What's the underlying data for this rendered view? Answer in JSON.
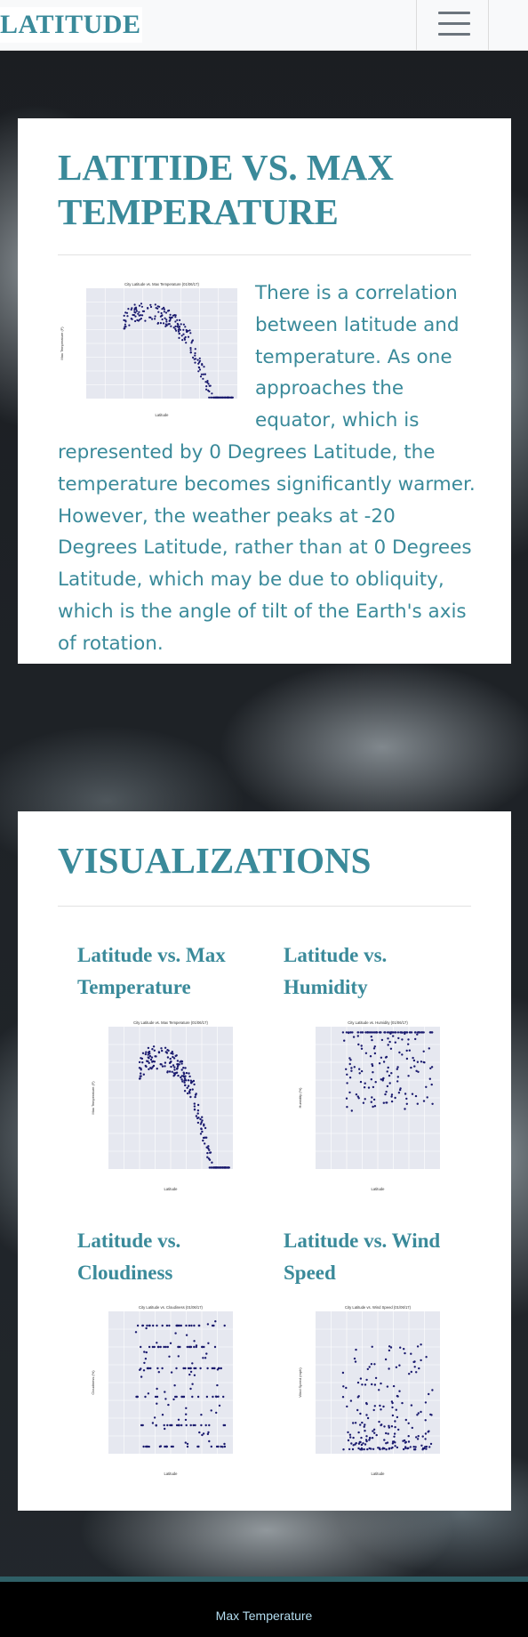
{
  "navbar": {
    "brand": "LATITUDE",
    "toggle_icon": "hamburger-menu-icon"
  },
  "summary": {
    "title": "LATITIDE VS. MAX TEMPERATURE",
    "description": "There is a correlation between latitude and temperature. As one approaches the equator, which is represented by 0 Degrees Latitude, the temperature becomes significantly warmer. However, the weather peaks at -20 Degrees Latitude, rather than at 0 Degrees Latitude, which may be due to obliquity, which is the angle of tilt of the Earth's axis of rotation."
  },
  "visualizations": {
    "title": "VISUALIZATIONS",
    "items": [
      {
        "label": "Latitude vs. Max Temperature",
        "plot_title": "City Latitude vs. Max Temperature (01/06/17)",
        "xlabel": "Latitude",
        "ylabel": "Max Temperature (F)"
      },
      {
        "label": "Latitude vs. Humidity",
        "plot_title": "City Latitude vs. Humidity (01/06/17)",
        "xlabel": "Latitude",
        "ylabel": "Humidity (%)"
      },
      {
        "label": "Latitude vs. Cloudiness",
        "plot_title": "City Latitude vs. Cloudiness (01/06/17)",
        "xlabel": "Latitude",
        "ylabel": "Cloudiness (%)"
      },
      {
        "label": "Latitude vs. Wind Speed",
        "plot_title": "City Latitude vs. Wind Speed (01/06/17)",
        "xlabel": "Latitude",
        "ylabel": "Wind Speed (mph)"
      }
    ]
  },
  "footer": {
    "text": "Max Temperature"
  },
  "colors": {
    "accent": "#3a8a9a",
    "plot_background": "#e6e8f0",
    "marker": "#1a1a6e",
    "footer_text": "#b4ddf0"
  }
}
